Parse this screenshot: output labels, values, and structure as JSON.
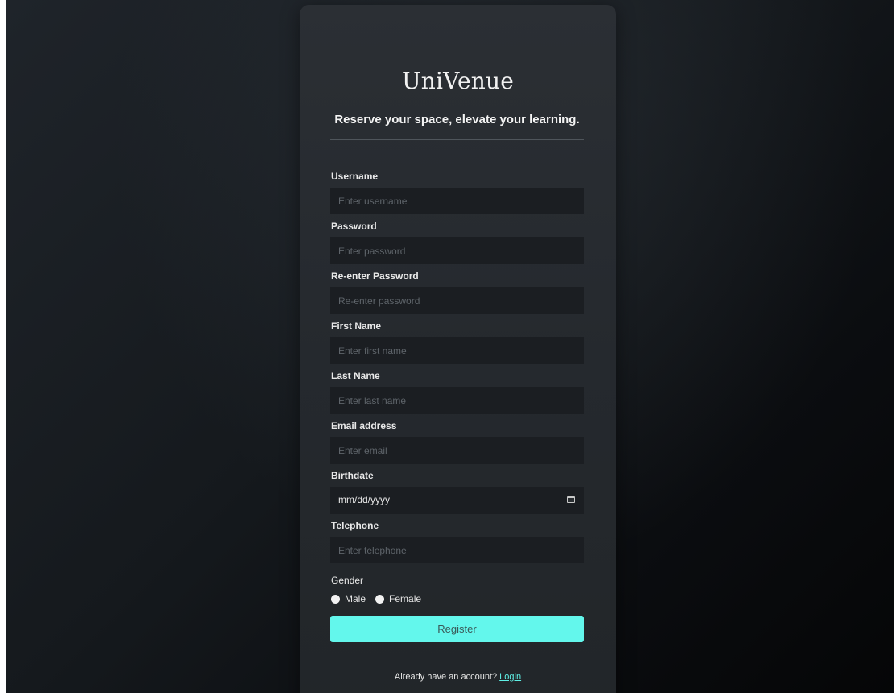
{
  "brand": {
    "title": "UniVenue",
    "tagline": "Reserve your space, elevate your learning."
  },
  "form": {
    "fields": [
      {
        "label": "Username",
        "placeholder": "Enter username"
      },
      {
        "label": "Password",
        "placeholder": "Enter password"
      },
      {
        "label": "Re-enter Password",
        "placeholder": "Re-enter password"
      },
      {
        "label": "First Name",
        "placeholder": "Enter first name"
      },
      {
        "label": "Last Name",
        "placeholder": "Enter last name"
      },
      {
        "label": "Email address",
        "placeholder": "Enter email"
      }
    ],
    "birthdate": {
      "label": "Birthdate",
      "value": "mm/dd/yyyy"
    },
    "telephone": {
      "label": "Telephone",
      "placeholder": "Enter telephone"
    },
    "gender": {
      "label": "Gender",
      "options": [
        "Male",
        "Female"
      ]
    },
    "register_label": "Register"
  },
  "footer": {
    "prompt": "Already have an account?",
    "login_label": "Login"
  },
  "colors": {
    "accent": "#63f7ec",
    "card": "#2b2f34",
    "input": "#1b1e22"
  },
  "icons": {
    "calendar": "calendar-icon",
    "radio": "radio-button"
  }
}
